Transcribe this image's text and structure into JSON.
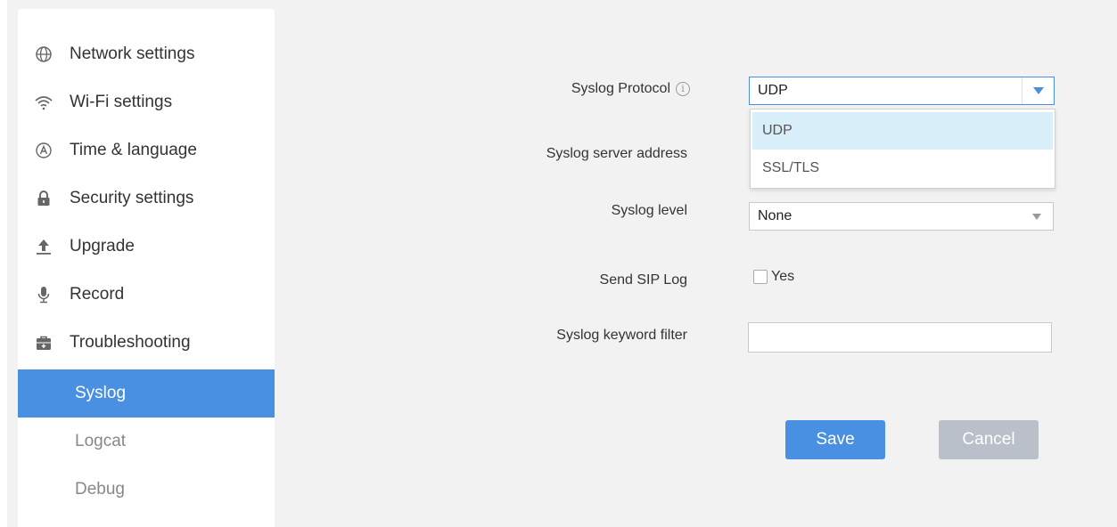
{
  "sidebar": {
    "items": [
      {
        "label": "Network settings",
        "icon": "globe-icon"
      },
      {
        "label": "Wi-Fi settings",
        "icon": "wifi-icon"
      },
      {
        "label": "Time & language",
        "icon": "language-icon"
      },
      {
        "label": "Security settings",
        "icon": "lock-icon"
      },
      {
        "label": "Upgrade",
        "icon": "upload-icon"
      },
      {
        "label": "Record",
        "icon": "microphone-icon"
      },
      {
        "label": "Troubleshooting",
        "icon": "toolbox-icon"
      }
    ],
    "sub_items": [
      {
        "label": "Syslog",
        "active": true
      },
      {
        "label": "Logcat",
        "active": false
      },
      {
        "label": "Debug",
        "active": false
      }
    ]
  },
  "form": {
    "protocol_label": "Syslog Protocol",
    "protocol_value": "UDP",
    "protocol_options": [
      "UDP",
      "SSL/TLS"
    ],
    "server_label": "Syslog server address",
    "level_label": "Syslog level",
    "level_value": "None",
    "sip_label": "Send SIP Log",
    "sip_checkbox_label": "Yes",
    "sip_checked": false,
    "keyword_label": "Syslog keyword filter",
    "keyword_value": ""
  },
  "buttons": {
    "save": "Save",
    "cancel": "Cancel"
  },
  "colors": {
    "accent": "#4a90e2",
    "cancel": "#b9c0c9",
    "highlight": "#d8eef8"
  }
}
